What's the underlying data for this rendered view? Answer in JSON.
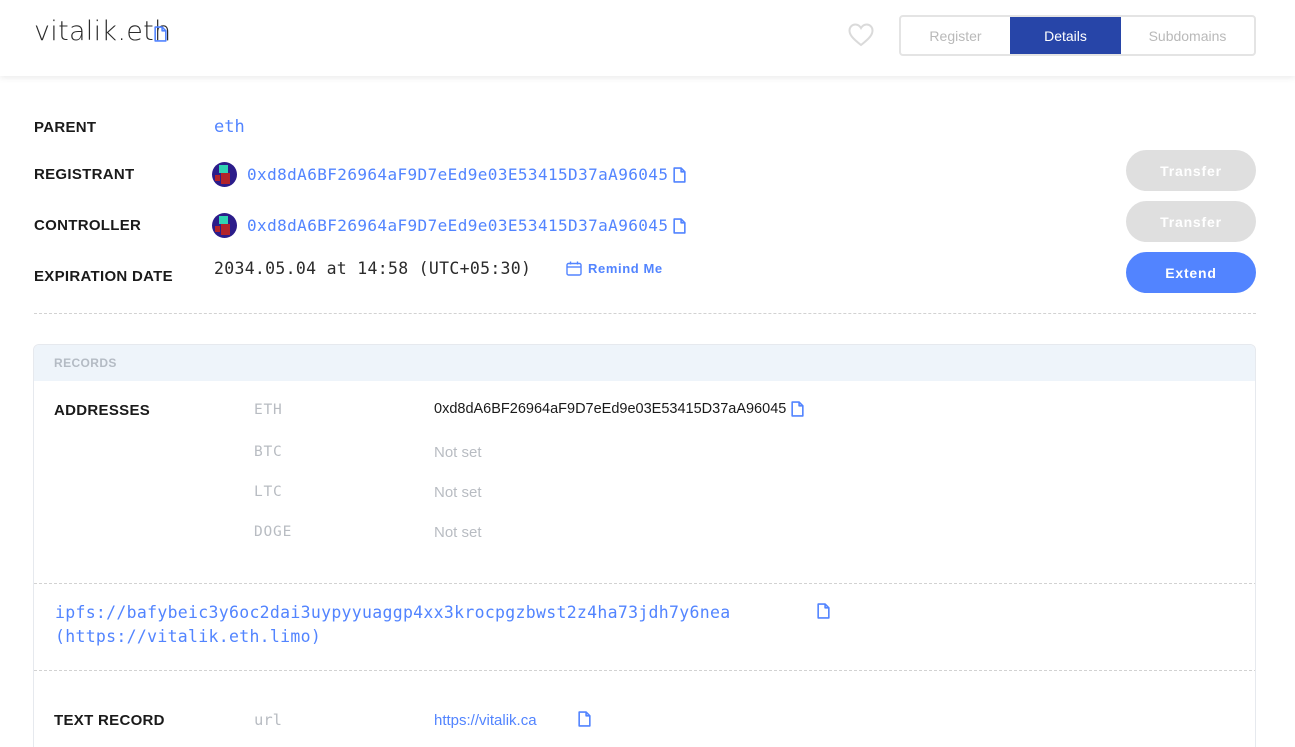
{
  "header": {
    "domain": "vitalik.eth",
    "tabs": [
      {
        "label": "Register",
        "active": false
      },
      {
        "label": "Details",
        "active": true
      },
      {
        "label": "Subdomains",
        "active": false
      }
    ]
  },
  "details": {
    "parent": {
      "label": "PARENT",
      "value": "eth"
    },
    "registrant": {
      "label": "REGISTRANT",
      "address": "0xd8dA6BF26964aF9D7eEd9e03E53415D37aA96045",
      "action": "Transfer"
    },
    "controller": {
      "label": "CONTROLLER",
      "address": "0xd8dA6BF26964aF9D7eEd9e03E53415D37aA96045",
      "action": "Transfer"
    },
    "expiration": {
      "label": "EXPIRATION DATE",
      "value": "2034.05.04 at 14:58 (UTC+05:30)",
      "remind": "Remind Me",
      "action": "Extend"
    }
  },
  "records": {
    "title": "RECORDS",
    "addresses_label": "ADDRESSES",
    "addresses": [
      {
        "coin": "ETH",
        "value": "0xd8dA6BF26964aF9D7eEd9e03E53415D37aA96045"
      },
      {
        "coin": "BTC",
        "value": "Not set"
      },
      {
        "coin": "LTC",
        "value": "Not set"
      },
      {
        "coin": "DOGE",
        "value": "Not set"
      }
    ],
    "content_hash": "ipfs://bafybeic3y6oc2dai3uypyyuaggp4xx3krocpgzbwst2z4ha73jdh7y6nea",
    "content_url": "(https://vitalik.eth.limo)",
    "text_record": {
      "label": "TEXT RECORD",
      "key": "url",
      "value": "https://vitalik.ca"
    }
  },
  "colors": {
    "accent": "#5284ff",
    "active_tab": "#2745a8",
    "disabled": "#dfdfdf"
  }
}
